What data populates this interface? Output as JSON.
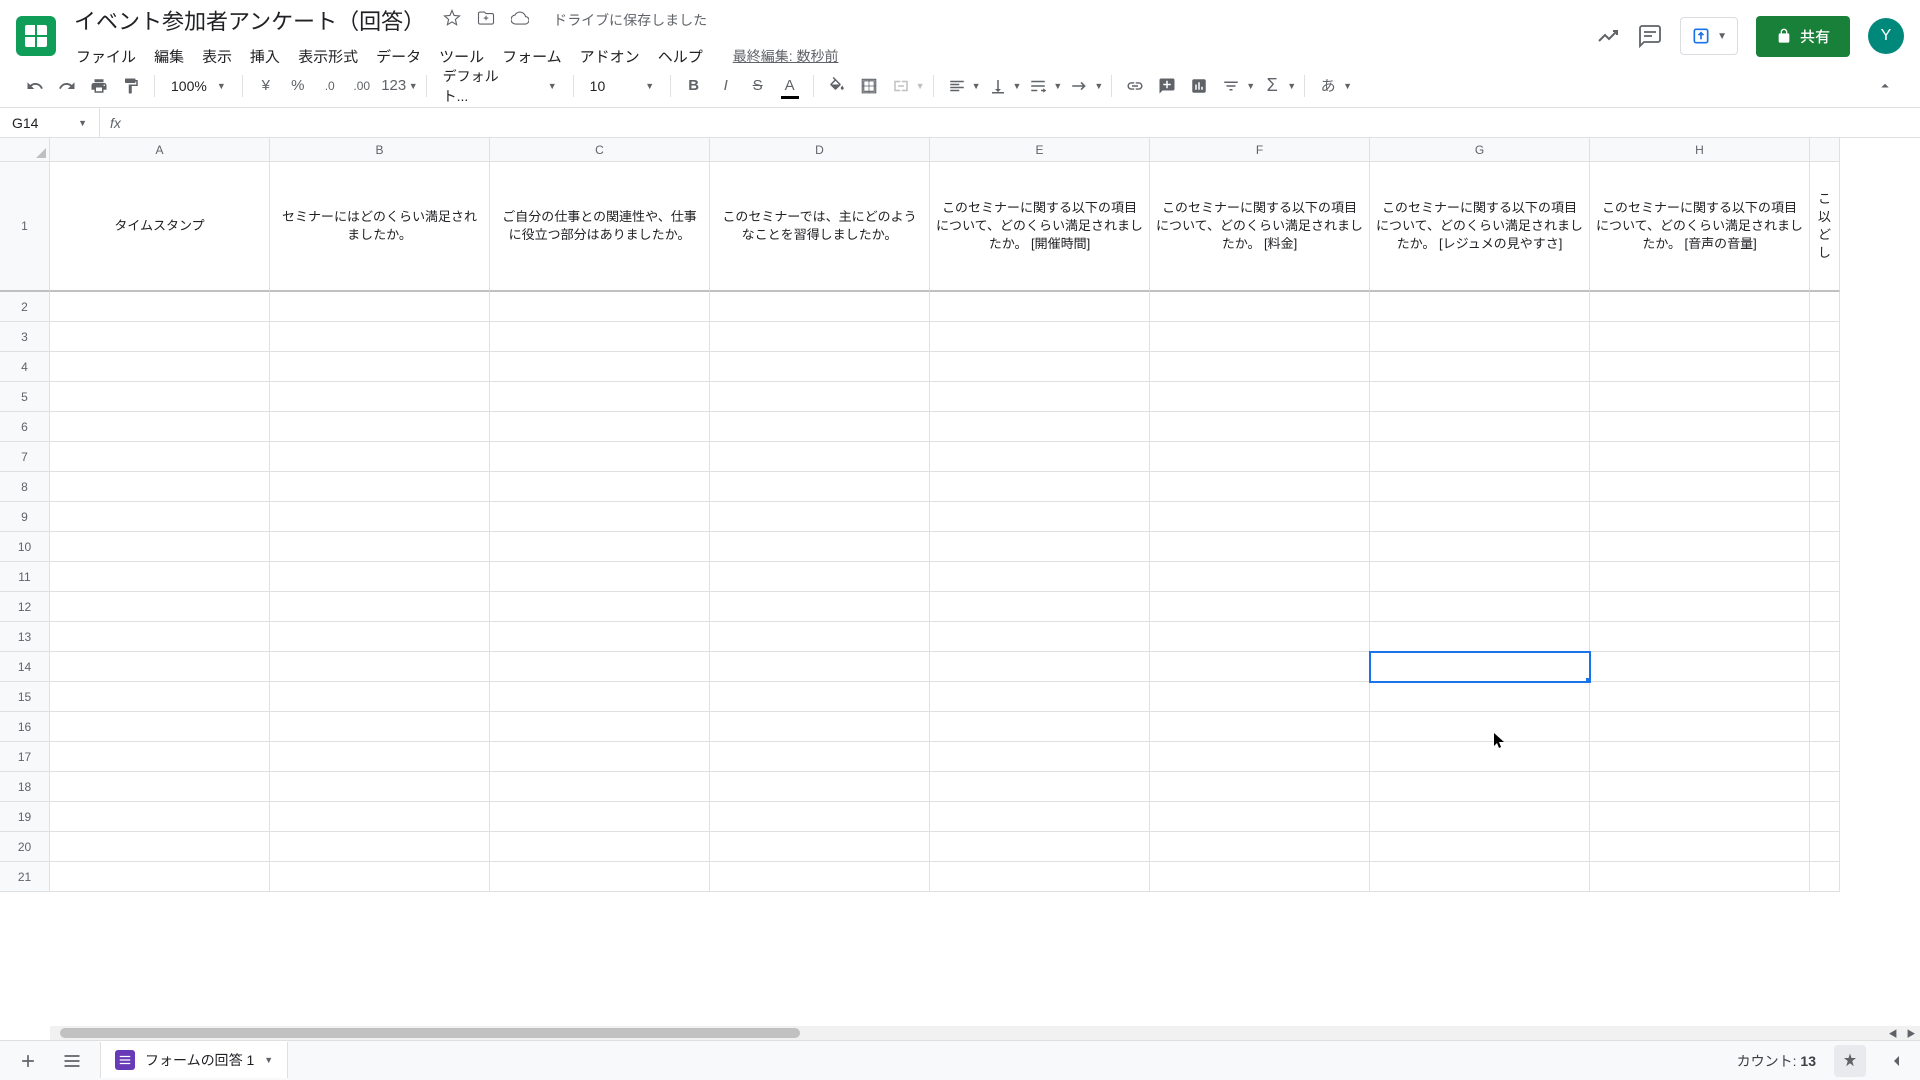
{
  "doc": {
    "title": "イベント参加者アンケート（回答）",
    "save_status": "ドライブに保存しました",
    "last_edit": "最終編集: 数秒前"
  },
  "menubar": [
    "ファイル",
    "編集",
    "表示",
    "挿入",
    "表示形式",
    "データ",
    "ツール",
    "フォーム",
    "アドオン",
    "ヘルプ"
  ],
  "toolbar": {
    "zoom": "100%",
    "currency": "¥",
    "percent": "%",
    "dec_dec": ".0",
    "inc_dec": ".00",
    "more_fmt": "123",
    "font": "デフォルト...",
    "font_size": "10",
    "ime": "あ"
  },
  "share": {
    "label": "共有"
  },
  "avatar": {
    "initial": "Y"
  },
  "name_box": "G14",
  "formula": "",
  "columns": [
    "A",
    "B",
    "C",
    "D",
    "E",
    "F",
    "G",
    "H",
    ""
  ],
  "headers_row": [
    "タイムスタンプ",
    "セミナーにはどのくらい満足されましたか。",
    "ご自分の仕事との関連性や、仕事に役立つ部分はありましたか。",
    "このセミナーでは、主にどのようなことを習得しましたか。",
    "このセミナーに関する以下の項目について、どのくらい満足されましたか。 [開催時間]",
    "このセミナーに関する以下の項目について、どのくらい満足されましたか。 [料金]",
    "このセミナーに関する以下の項目について、どのくらい満足されましたか。 [レジュメの見やすさ]",
    "このセミナーに関する以下の項目について、どのくらい満足されましたか。 [音声の音量]",
    "こ 以 ど し"
  ],
  "row_numbers": [
    1,
    2,
    3,
    4,
    5,
    6,
    7,
    8,
    9,
    10,
    11,
    12,
    13,
    14,
    15,
    16,
    17,
    18,
    19,
    20,
    21
  ],
  "selected_cell": {
    "col": "G",
    "row": 14
  },
  "sheet_tab": {
    "name": "フォームの回答 1"
  },
  "status": {
    "count_label": "カウント:",
    "count_value": "13"
  }
}
